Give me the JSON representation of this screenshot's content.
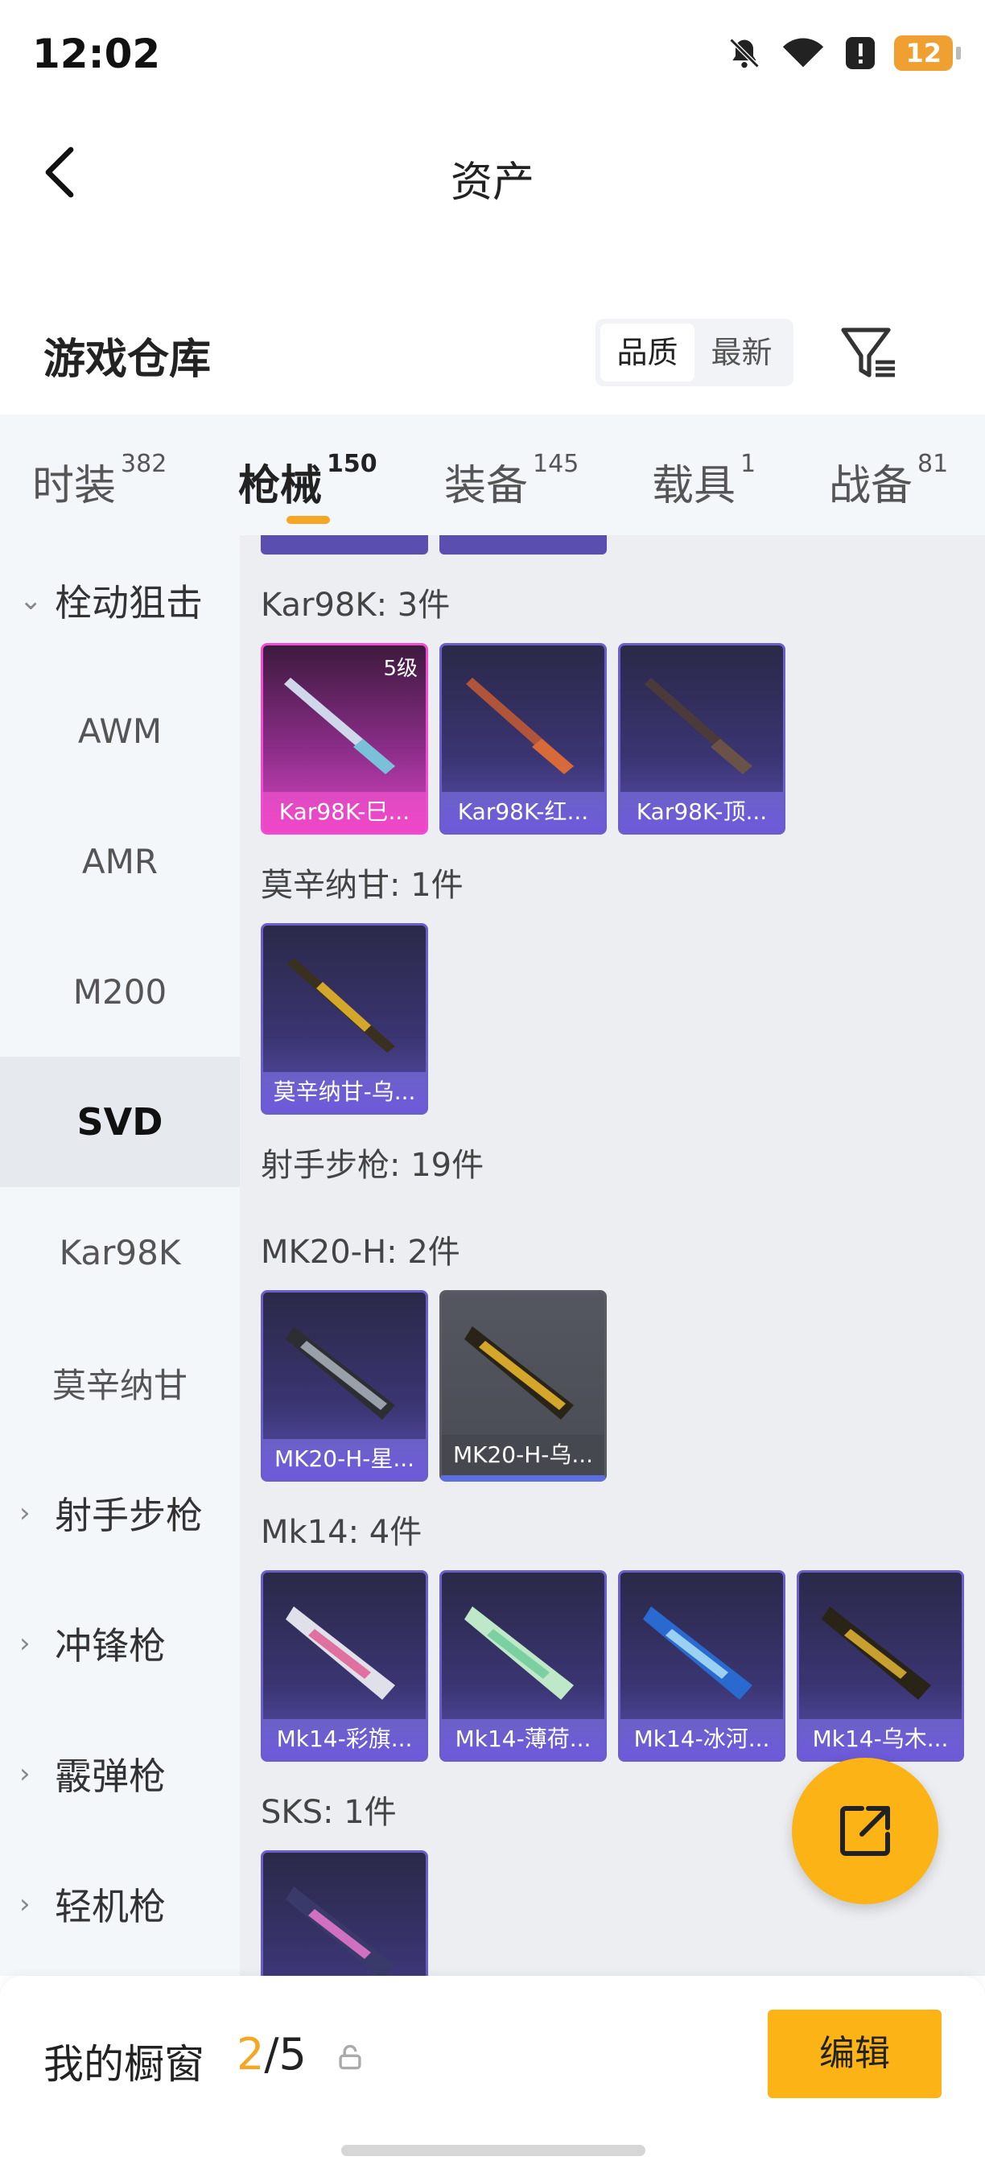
{
  "status": {
    "time": "12:02",
    "battery": "12"
  },
  "header": {
    "title": "资产"
  },
  "warehouse": {
    "title": "游戏仓库",
    "sort_quality": "品质",
    "sort_newest": "最新"
  },
  "tabs": [
    {
      "label": "时装",
      "count": "382"
    },
    {
      "label": "枪械",
      "count": "150"
    },
    {
      "label": "装备",
      "count": "145"
    },
    {
      "label": "载具",
      "count": "1"
    },
    {
      "label": "战备",
      "count": "81"
    }
  ],
  "sidebar": {
    "group_sniper": "栓动狙击",
    "items": [
      "AWM",
      "AMR",
      "M200",
      "SVD",
      "Kar98K",
      "莫辛纳甘"
    ],
    "group_dmr": "射手步枪",
    "group_smg": "冲锋枪",
    "group_shotgun": "霰弹枪",
    "group_lmg": "轻机枪"
  },
  "sections": {
    "kar98k": "Kar98K: 3件",
    "mosin": "莫辛纳甘: 1件",
    "dmr": "射手步枪: 19件",
    "mk20": "MK20-H: 2件",
    "mk14": "Mk14: 4件",
    "sks": "SKS: 1件"
  },
  "cards": {
    "kar1": {
      "label": "Kar98K-巳...",
      "level": "5级"
    },
    "kar2": {
      "label": "Kar98K-红..."
    },
    "kar3": {
      "label": "Kar98K-顶..."
    },
    "mosin1": {
      "label": "莫辛纳甘-乌..."
    },
    "mk20_1": {
      "label": "MK20-H-星..."
    },
    "mk20_2": {
      "label": "MK20-H-乌..."
    },
    "mk14_1": {
      "label": "Mk14-彩旗..."
    },
    "mk14_2": {
      "label": "Mk14-薄荷..."
    },
    "mk14_3": {
      "label": "Mk14-冰河..."
    },
    "mk14_4": {
      "label": "Mk14-乌木..."
    }
  },
  "showcase": {
    "label": "我的橱窗",
    "current": "2",
    "total": "/5"
  },
  "edit_button": "编辑",
  "colors": {
    "accent": "#fbb315",
    "tab_underline": "#f5a623",
    "rare_purple": "#6a5ec8",
    "legendary_pink": "#f04bd2"
  }
}
